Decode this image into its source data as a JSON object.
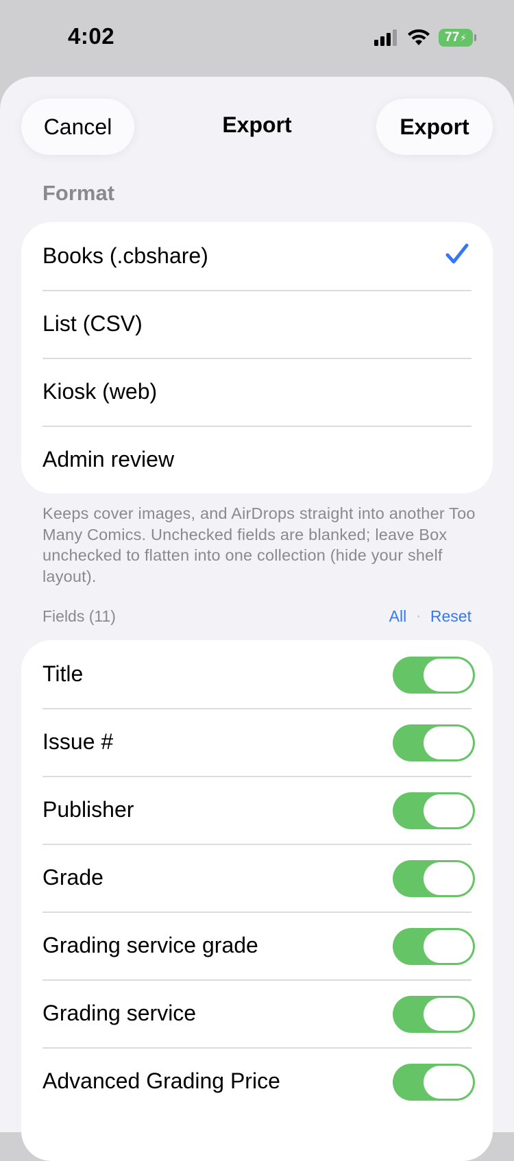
{
  "status": {
    "time": "4:02",
    "battery": "77"
  },
  "nav": {
    "cancel_label": "Cancel",
    "title": "Export",
    "export_label": "Export"
  },
  "format": {
    "header": "Format",
    "options": [
      {
        "label": "Books (.cbshare)",
        "selected": true
      },
      {
        "label": "List (CSV)",
        "selected": false
      },
      {
        "label": "Kiosk (web)",
        "selected": false
      },
      {
        "label": "Admin review",
        "selected": false
      }
    ],
    "footer": "Keeps cover images, and AirDrops straight into another Too Many Comics. Unchecked fields are blanked; leave Box unchecked to flatten into one collection (hide your shelf layout)."
  },
  "fields": {
    "header": "Fields (11)",
    "all_label": "All",
    "separator": "·",
    "reset_label": "Reset",
    "items": [
      {
        "label": "Title",
        "on": true
      },
      {
        "label": "Issue #",
        "on": true
      },
      {
        "label": "Publisher",
        "on": true
      },
      {
        "label": "Grade",
        "on": true
      },
      {
        "label": "Grading service grade",
        "on": true
      },
      {
        "label": "Grading service",
        "on": true
      },
      {
        "label": "Advanced Grading Price",
        "on": true
      }
    ]
  },
  "colors": {
    "accent": "#3478f6",
    "toggle_on": "#65c466",
    "background": "#f2f2f7"
  }
}
